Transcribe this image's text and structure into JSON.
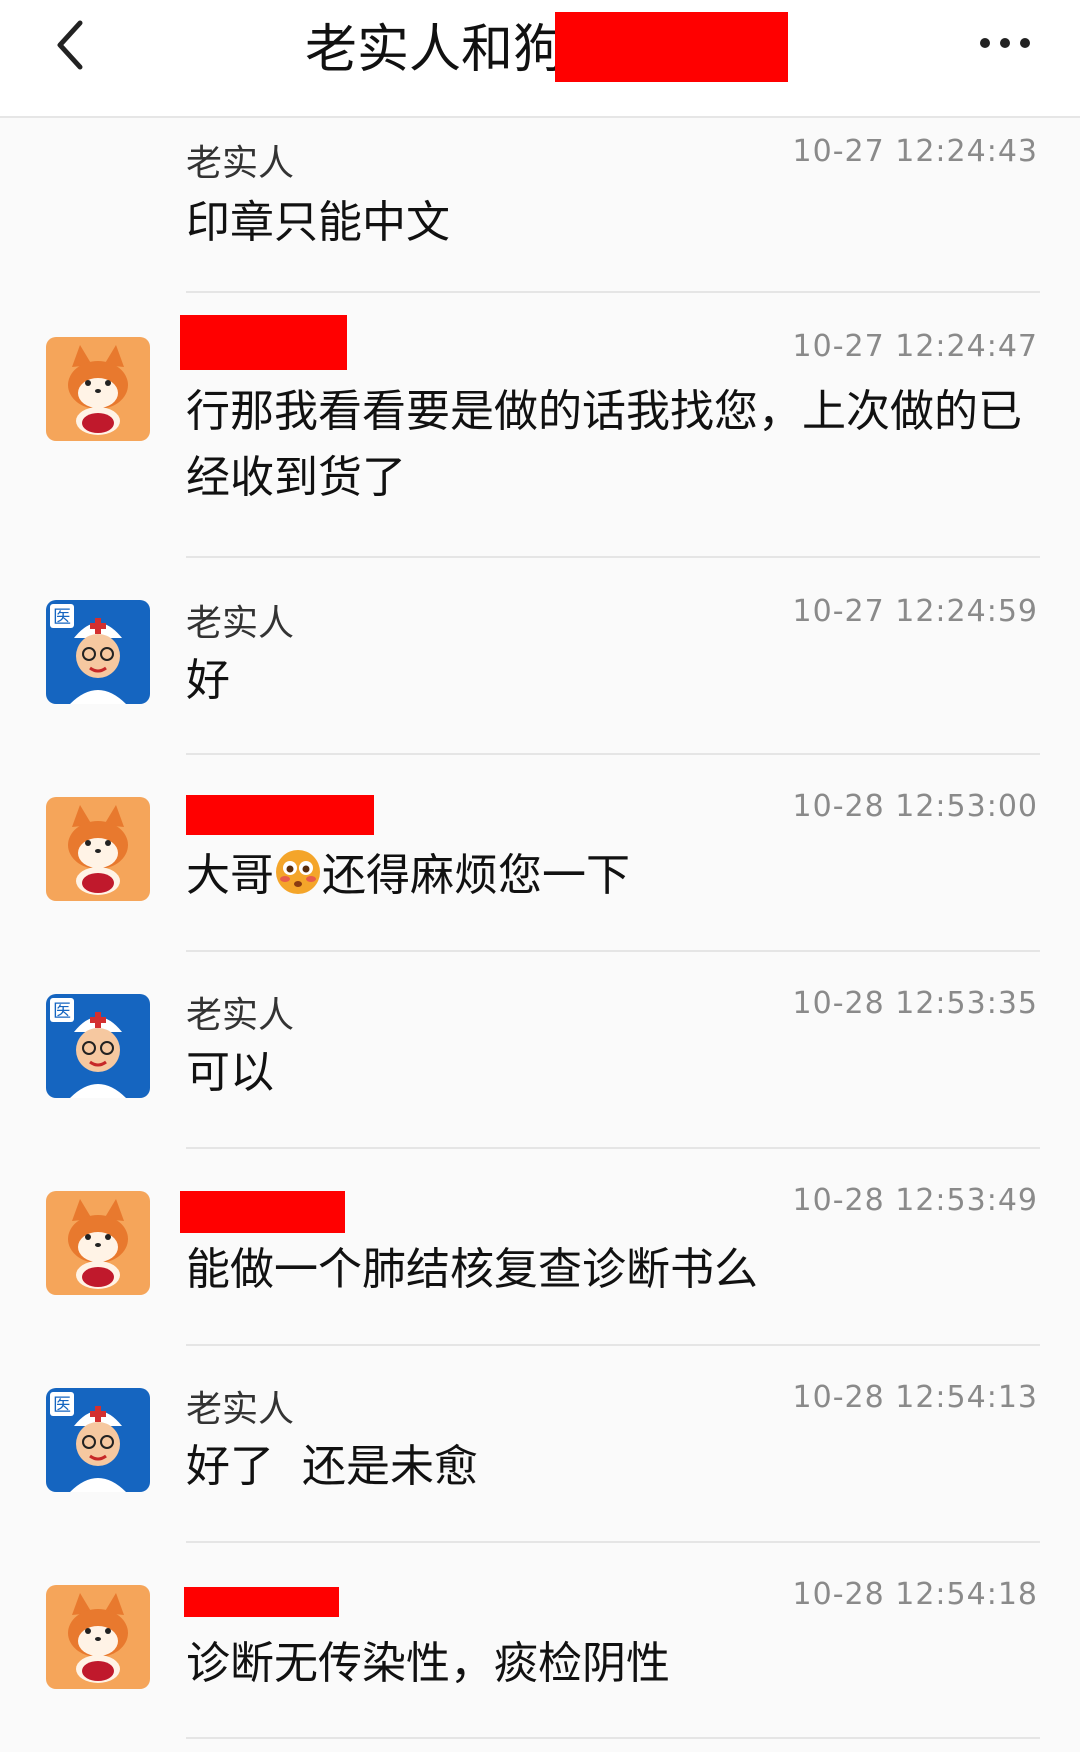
{
  "header": {
    "title": "老实人和狗",
    "back_icon": "chevron-left-icon",
    "more_icon": "ellipsis-icon"
  },
  "messages": [
    {
      "sender": "老实人",
      "time": "10-27 12:24:43",
      "text": "印章只能中文",
      "avatar": "none",
      "redacted_name": false
    },
    {
      "sender": "",
      "time": "10-27 12:24:47",
      "text": "行那我看看要是做的话我找您，上次做的已经收到货了",
      "avatar": "shiba-avatar",
      "redacted_name": true
    },
    {
      "sender": "老实人",
      "time": "10-27 12:24:59",
      "text": "好",
      "avatar": "doctor-avatar",
      "redacted_name": false
    },
    {
      "sender": "",
      "time": "10-28 12:53:00",
      "text_before": "大哥",
      "text_after": "还得麻烦您一下",
      "emoji": "flushed-face-icon",
      "avatar": "shiba-avatar",
      "redacted_name": true
    },
    {
      "sender": "老实人",
      "time": "10-28 12:53:35",
      "text": "可以",
      "avatar": "doctor-avatar",
      "redacted_name": false
    },
    {
      "sender": "",
      "time": "10-28 12:53:49",
      "text": "能做一个肺结核复查诊断书么",
      "avatar": "shiba-avatar",
      "redacted_name": true
    },
    {
      "sender": "老实人",
      "time": "10-28 12:54:13",
      "text": "好了  还是未愈",
      "avatar": "doctor-avatar",
      "redacted_name": false
    },
    {
      "sender": "",
      "time": "10-28 12:54:18",
      "text": "诊断无传染性，痰检阴性",
      "avatar": "shiba-avatar",
      "redacted_name": true
    }
  ],
  "colors": {
    "redaction": "#ff0000",
    "timestamp": "#8a8a8a",
    "divider": "#e5e5e5",
    "background": "#fafafa"
  },
  "avatar_text": {
    "doctor_badge": "医"
  }
}
